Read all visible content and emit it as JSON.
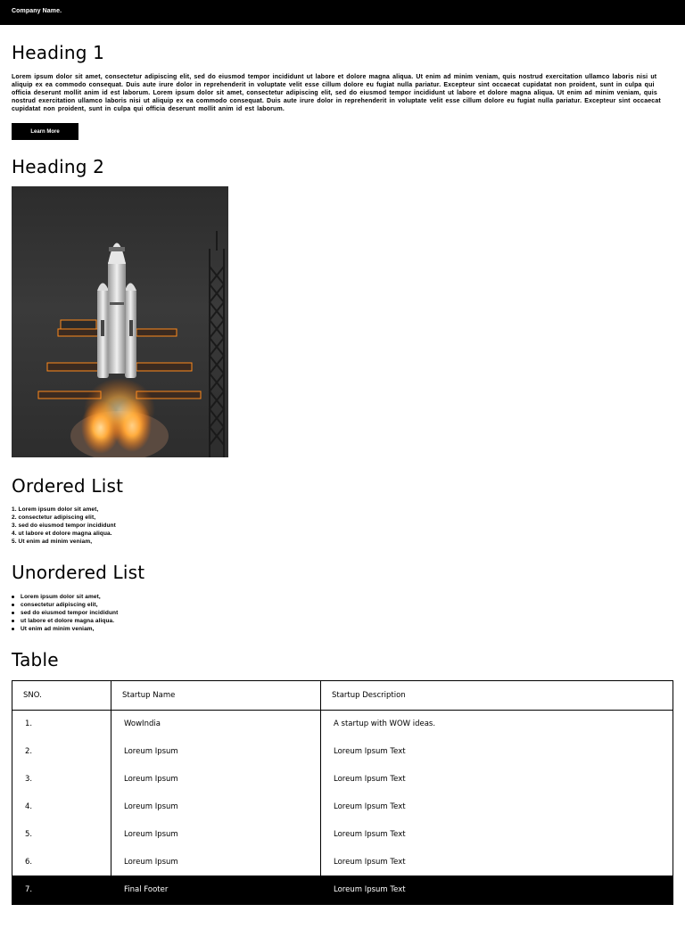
{
  "header": {
    "brand": "Company Name."
  },
  "section1": {
    "heading": "Heading 1",
    "paragraph": "Lorem ipsum dolor sit amet, consectetur adipiscing elit, sed do eiusmod tempor incididunt ut labore et dolore magna aliqua. Ut enim ad minim veniam, quis nostrud exercitation ullamco laboris nisi ut aliquip ex ea commodo consequat. Duis aute irure dolor in reprehenderit in voluptate velit esse cillum dolore eu fugiat nulla pariatur. Excepteur sint occaecat cupidatat non proident, sunt in culpa qui officia deserunt mollit anim id est laborum. Lorem ipsum dolor sit amet, consectetur adipiscing elit, sed do eiusmod tempor incididunt ut labore et dolore magna aliqua. Ut enim ad minim veniam, quis nostrud exercitation ullamco laboris nisi ut aliquip ex ea commodo consequat. Duis aute irure dolor in reprehenderit in voluptate velit esse cillum dolore eu fugiat nulla pariatur. Excepteur sint occaecat cupidatat non proident, sunt in culpa qui officia deserunt mollit anim id est laborum.",
    "button": "Learn More"
  },
  "section2": {
    "heading": "Heading 2"
  },
  "ordered": {
    "heading": "Ordered List",
    "items": [
      "1. Lorem ipsum dolor sit amet,",
      "2. consectetur adipiscing elit,",
      "3. sed do eiusmod tempor incididunt",
      "4. ut labore et dolore magna aliqua.",
      "5. Ut enim ad minim veniam,"
    ]
  },
  "unordered": {
    "heading": "Unordered List",
    "items": [
      "Lorem ipsum dolor sit amet,",
      "consectetur adipiscing elit,",
      "sed do eiusmod tempor incididunt",
      "ut labore et dolore magna aliqua.",
      "Ut enim ad minim veniam,"
    ]
  },
  "table": {
    "heading": "Table",
    "columns": [
      "SNO.",
      "Startup Name",
      "Startup Description"
    ],
    "rows": [
      [
        "1.",
        "WowIndia",
        "A startup with WOW ideas."
      ],
      [
        "2.",
        "Loreum Ipsum",
        "Loreum Ipsum Text"
      ],
      [
        "3.",
        "Loreum Ipsum",
        "Loreum Ipsum Text"
      ],
      [
        "4.",
        "Loreum Ipsum",
        "Loreum Ipsum Text"
      ],
      [
        "5.",
        "Loreum Ipsum",
        "Loreum Ipsum Text"
      ],
      [
        "6.",
        "Loreum Ipsum",
        "Loreum Ipsum Text"
      ]
    ],
    "footer": [
      "7.",
      "Final Footer",
      "Loreum Ipsum Text"
    ]
  },
  "colors": {
    "bar": "#000000",
    "background": "#ffffff",
    "flame": "#ff8a1c"
  },
  "image": {
    "subject": "rocket-launch-photo"
  }
}
